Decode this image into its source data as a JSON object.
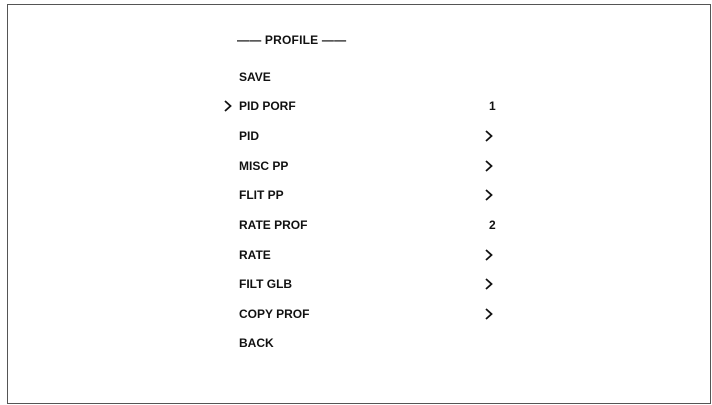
{
  "menu": {
    "title": "—— PROFILE ——",
    "items": [
      {
        "label": "SAVE",
        "value": null,
        "submenu": false,
        "selected": false
      },
      {
        "label": "PID PORF",
        "value": "1",
        "submenu": false,
        "selected": true
      },
      {
        "label": "PID",
        "value": null,
        "submenu": true,
        "selected": false
      },
      {
        "label": "MISC PP",
        "value": null,
        "submenu": true,
        "selected": false
      },
      {
        "label": "FLIT PP",
        "value": null,
        "submenu": true,
        "selected": false
      },
      {
        "label": "RATE PROF",
        "value": "2",
        "submenu": false,
        "selected": false
      },
      {
        "label": "RATE",
        "value": null,
        "submenu": true,
        "selected": false
      },
      {
        "label": "FILT GLB",
        "value": null,
        "submenu": true,
        "selected": false
      },
      {
        "label": "COPY PROF",
        "value": null,
        "submenu": true,
        "selected": false
      },
      {
        "label": "BACK",
        "value": null,
        "submenu": false,
        "selected": false
      }
    ],
    "icons": {
      "cursor": "chevron-right-icon",
      "submenu": "chevron-right-icon"
    }
  }
}
